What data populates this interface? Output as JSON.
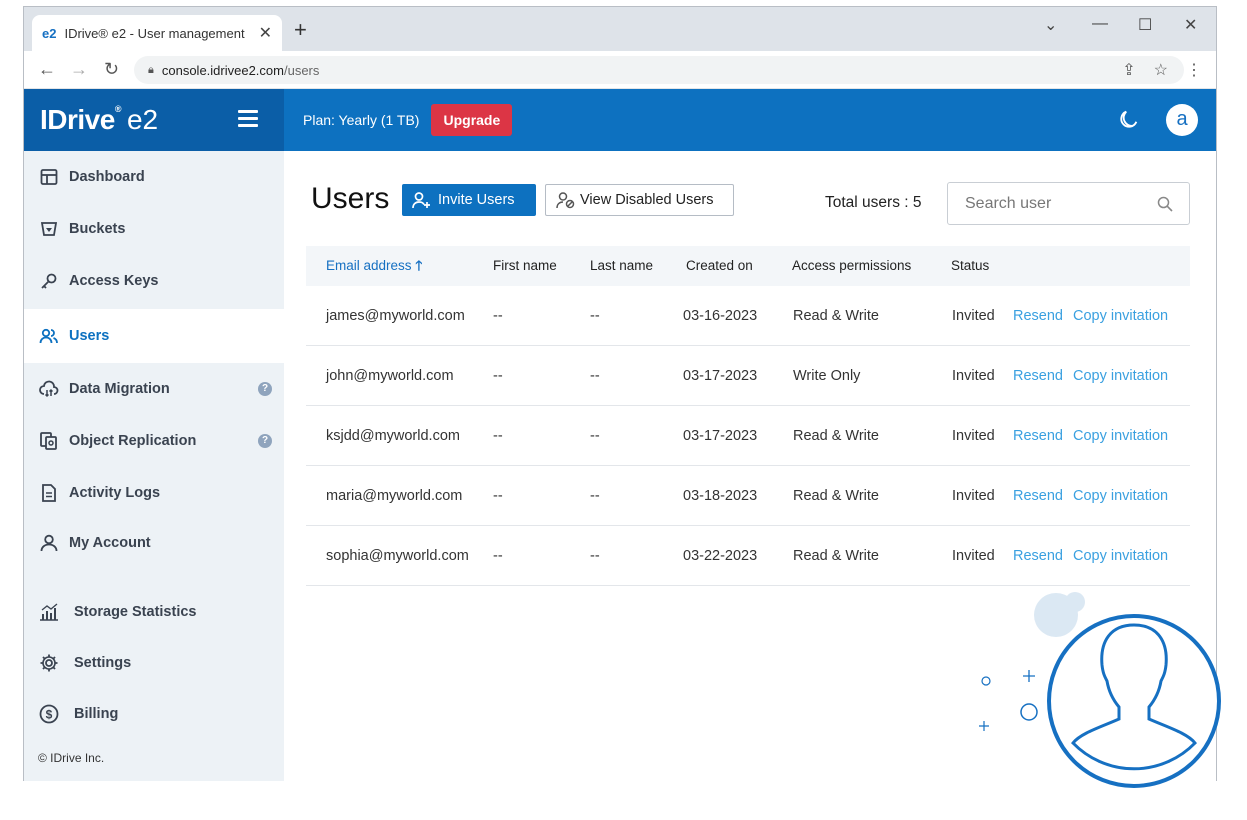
{
  "browser": {
    "tab_favicon": "e2",
    "tab_title": "IDrive® e2 - User management",
    "url_host": "console.idrivee2.com",
    "url_path": "/users"
  },
  "brand": {
    "logo": "IDrive",
    "reg": "®",
    "product": "e2"
  },
  "topbar": {
    "plan": "Plan: Yearly (1 TB)",
    "upgrade": "Upgrade",
    "avatar_initial": "a"
  },
  "sidebar": {
    "items": [
      {
        "label": "Dashboard",
        "icon": "dashboard-icon"
      },
      {
        "label": "Buckets",
        "icon": "bucket-icon"
      },
      {
        "label": "Access Keys",
        "icon": "key-icon"
      },
      {
        "label": "Users",
        "icon": "users-icon",
        "active": true
      },
      {
        "label": "Data Migration",
        "icon": "cloud-migration-icon",
        "help": "?"
      },
      {
        "label": "Object Replication",
        "icon": "replication-icon",
        "help": "?"
      },
      {
        "label": "Activity Logs",
        "icon": "log-icon"
      },
      {
        "label": "My Account",
        "icon": "account-icon"
      },
      {
        "label": "Storage Statistics",
        "icon": "chart-icon"
      },
      {
        "label": "Settings",
        "icon": "gear-icon"
      },
      {
        "label": "Billing",
        "icon": "dollar-icon"
      }
    ],
    "copyright": "© IDrive Inc."
  },
  "main": {
    "title": "Users",
    "invite_button": "Invite Users",
    "disabled_button": "View Disabled Users",
    "total_users": "Total users : 5",
    "search_placeholder": "Search user"
  },
  "table": {
    "headers": [
      "Email address",
      "First name",
      "Last name",
      "Created on",
      "Access permissions",
      "Status"
    ],
    "rows": [
      {
        "email": "james@myworld.com",
        "first": "--",
        "last": "--",
        "created": "03-16-2023",
        "access": "Read & Write",
        "status": "Invited",
        "resend": "Resend",
        "copy": "Copy invitation"
      },
      {
        "email": "john@myworld.com",
        "first": "--",
        "last": "--",
        "created": "03-17-2023",
        "access": "Write Only",
        "status": "Invited",
        "resend": "Resend",
        "copy": "Copy invitation"
      },
      {
        "email": "ksjdd@myworld.com",
        "first": "--",
        "last": "--",
        "created": "03-17-2023",
        "access": "Read & Write",
        "status": "Invited",
        "resend": "Resend",
        "copy": "Copy invitation"
      },
      {
        "email": "maria@myworld.com",
        "first": "--",
        "last": "--",
        "created": "03-18-2023",
        "access": "Read & Write",
        "status": "Invited",
        "resend": "Resend",
        "copy": "Copy invitation"
      },
      {
        "email": "sophia@myworld.com",
        "first": "--",
        "last": "--",
        "created": "03-22-2023",
        "access": "Read & Write",
        "status": "Invited",
        "resend": "Resend",
        "copy": "Copy invitation"
      }
    ]
  },
  "colors": {
    "brand_dark": "#0b5ea7",
    "brand": "#0d71c0",
    "upgrade": "#dc3545",
    "link": "#3aa0e0",
    "sidebar_bg": "#edf2f6"
  }
}
